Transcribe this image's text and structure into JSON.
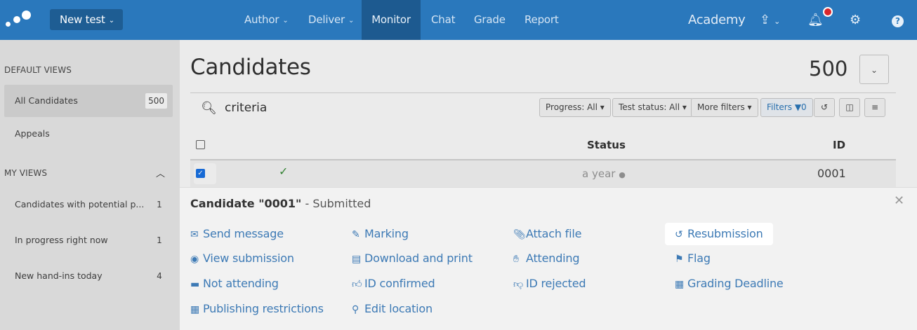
{
  "nav": {
    "new_test": "New test",
    "items": [
      "Author",
      "Deliver",
      "Monitor",
      "Chat",
      "Grade",
      "Report"
    ],
    "academy": "Academy"
  },
  "sidebar": {
    "default_heading": "DEFAULT VIEWS",
    "default_items": [
      {
        "label": "All Candidates",
        "count": "500"
      },
      {
        "label": "Appeals"
      }
    ],
    "my_heading": "MY VIEWS",
    "my_items": [
      {
        "label": "Candidates with potential p...",
        "count": "1"
      },
      {
        "label": "In progress right now",
        "count": "1"
      },
      {
        "label": "New hand-ins today",
        "count": "4"
      }
    ]
  },
  "main": {
    "title": "Candidates",
    "count": "500",
    "search": "criteria",
    "filters": {
      "progress": "Progress: All",
      "test_status": "Test status: All",
      "more": "More filters",
      "filters": "Filters",
      "filters_count": "0"
    },
    "columns": {
      "status": "Status",
      "id": "ID"
    },
    "row": {
      "status": "a year",
      "id": "0001"
    }
  },
  "popup": {
    "title_bold": "Candidate \"0001\"",
    "title_rest": " - Submitted",
    "actions": {
      "send_message": "Send message",
      "view_submission": "View submission",
      "not_attending": "Not attending",
      "publishing_restrictions": "Publishing restrictions",
      "marking": "Marking",
      "download_print": "Download and print",
      "id_confirmed": "ID confirmed",
      "edit_location": "Edit location",
      "attach_file": "Attach file",
      "attending": "Attending",
      "id_rejected": "ID rejected",
      "resubmission": "Resubmission",
      "flag": "Flag",
      "grading_deadline": "Grading Deadline"
    }
  },
  "colors": {
    "topbar": "#2a78bc",
    "link": "#3d7ab5",
    "notify": "#d9262c"
  }
}
